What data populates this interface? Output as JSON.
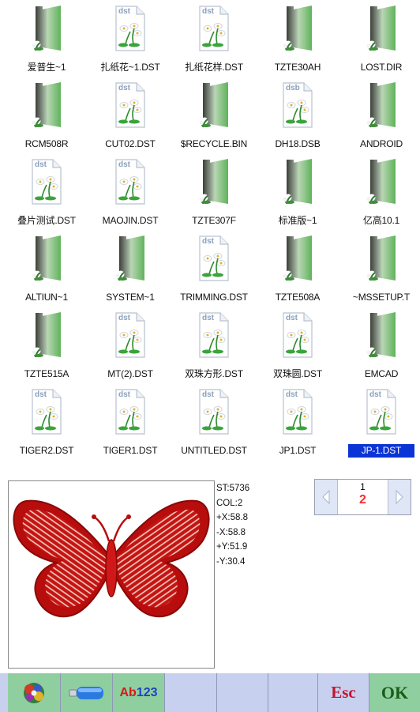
{
  "files": [
    {
      "name": "爱普生~1",
      "type": "folder"
    },
    {
      "name": "扎纸花~1.DST",
      "type": "dst"
    },
    {
      "name": "扎纸花样.DST",
      "type": "dst"
    },
    {
      "name": "TZTE30AH",
      "type": "folder"
    },
    {
      "name": "LOST.DIR",
      "type": "folder"
    },
    {
      "name": "RCM508R",
      "type": "folder"
    },
    {
      "name": "CUT02.DST",
      "type": "dst"
    },
    {
      "name": "$RECYCLE.BIN",
      "type": "folder"
    },
    {
      "name": "DH18.DSB",
      "type": "dsb"
    },
    {
      "name": "ANDROID",
      "type": "folder"
    },
    {
      "name": "叠片测试.DST",
      "type": "dst"
    },
    {
      "name": "MAOJIN.DST",
      "type": "dst"
    },
    {
      "name": "TZTE307F",
      "type": "folder"
    },
    {
      "name": "标准版~1",
      "type": "folder"
    },
    {
      "name": "亿高10.1",
      "type": "folder"
    },
    {
      "name": "ALTIUN~1",
      "type": "folder"
    },
    {
      "name": "SYSTEM~1",
      "type": "folder"
    },
    {
      "name": "TRIMMING.DST",
      "type": "dst"
    },
    {
      "name": "TZTE508A",
      "type": "folder"
    },
    {
      "name": "~MSSETUP.T",
      "type": "folder"
    },
    {
      "name": "TZTE515A",
      "type": "folder"
    },
    {
      "name": "MT(2).DST",
      "type": "dst"
    },
    {
      "name": "双珠方形.DST",
      "type": "dst"
    },
    {
      "name": "双珠圆.DST",
      "type": "dst"
    },
    {
      "name": "EMCAD",
      "type": "folder"
    },
    {
      "name": "TIGER2.DST",
      "type": "dst"
    },
    {
      "name": "TIGER1.DST",
      "type": "dst"
    },
    {
      "name": "UNTITLED.DST",
      "type": "dst"
    },
    {
      "name": "JP1.DST",
      "type": "dst"
    },
    {
      "name": "JP-1.DST",
      "type": "dst",
      "selected": true
    }
  ],
  "preview": {
    "icon": "butterfly-embroidery",
    "color": "#d01818"
  },
  "stats": {
    "st": "ST:5736",
    "col": "COL:2",
    "px": "+X:58.8",
    "nx": "-X:58.8",
    "py": "+Y:51.9",
    "ny": "-Y:30.4"
  },
  "pager": {
    "current": "1",
    "total": "2"
  },
  "toolbar": {
    "pattern_icon": "flower-pattern-icon",
    "usb_icon": "usb-drive-icon",
    "text_ab": "Ab",
    "text_123": "123",
    "esc": "Esc",
    "ok": "OK"
  },
  "colors": {
    "selection": "#0b34d6",
    "toolbar": "#c8d0ef",
    "ok_button": "#8fcf9f",
    "esc_text": "#c0152f"
  }
}
